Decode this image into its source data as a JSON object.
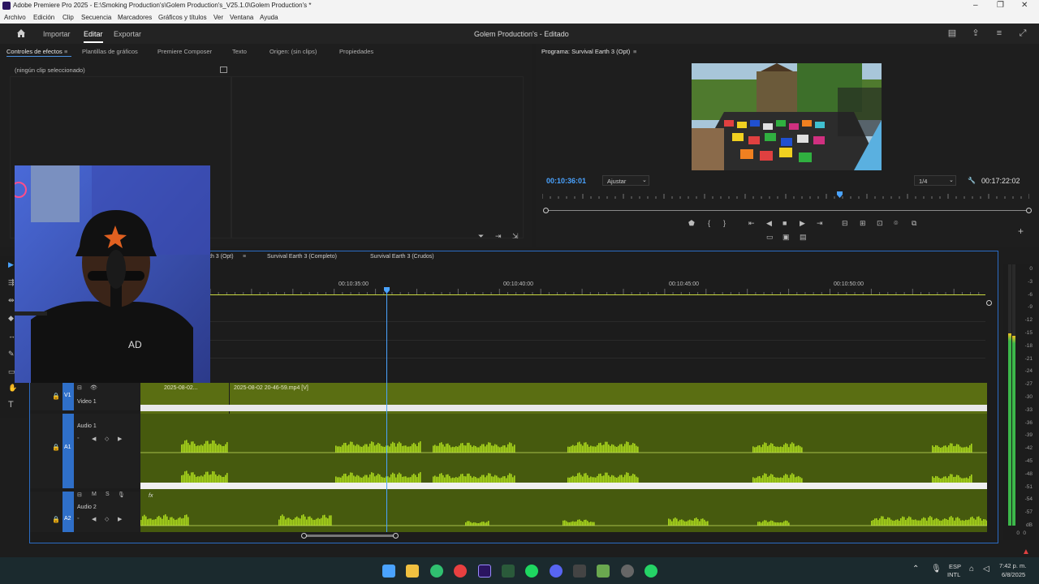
{
  "window": {
    "title": "Adobe Premiere Pro 2025 - E:\\Smoking Production's\\Golem Production's_V25.1.0\\Golem Production's *"
  },
  "menu": [
    "Archivo",
    "Edición",
    "Clip",
    "Secuencia",
    "Marcadores",
    "Gráficos y títulos",
    "Ver",
    "Ventana",
    "Ayuda"
  ],
  "header": {
    "tabs": [
      "Importar",
      "Editar",
      "Exportar"
    ],
    "project_title": "Golem Production's - Editado"
  },
  "effect_panel": {
    "tabs": [
      "Controles de efectos",
      "Plantillas de gráficos",
      "Premiere Composer",
      "Texto",
      "Origen: (sin clips)",
      "Propiedades"
    ],
    "empty_text": "(ningún clip seleccionado)"
  },
  "program": {
    "title": "Programa: Survival Earth 3 (Opt)",
    "timecode": "00:10:36:01",
    "fit": "Ajustar",
    "resolution": "1/4",
    "duration": "00:17:22:02",
    "playhead_fraction": 0.61
  },
  "timeline": {
    "tabs": [
      "th 3 (Opt)",
      "Survival Earth 3 (Completo)",
      "Survival Earth 3 (Crudos)"
    ],
    "ruler": [
      "00:10:35:00",
      "00:10:40:00",
      "00:10:45:00",
      "00:10:50:00"
    ],
    "tracks": {
      "v1": {
        "id": "V1",
        "name": "Video 1"
      },
      "a1": {
        "id": "A1",
        "name": "Audio 1"
      },
      "a2": {
        "id": "A2",
        "name": "Audio 2"
      }
    },
    "clips": {
      "clip1": "2025-08-02...",
      "clip2": "2025-08-02 20-46-59.mp4 [V]"
    }
  },
  "meters": {
    "scale": [
      "0",
      "-3",
      "-6",
      "-9",
      "-12",
      "-15",
      "-18",
      "-21",
      "-24",
      "-27",
      "-30",
      "-33",
      "-36",
      "-39",
      "-42",
      "-45",
      "-48",
      "-51",
      "-54",
      "-57",
      "dB"
    ],
    "bottom": [
      "0",
      "0"
    ]
  },
  "taskbar": {
    "lang": "ESP",
    "layout": "INTL",
    "time": "7:42 p. m.",
    "date": "6/8/2025"
  },
  "colors": {
    "accent": "#2b6cc4",
    "video_track": "#5a6e12",
    "audio_wave": "#a8d61c"
  }
}
